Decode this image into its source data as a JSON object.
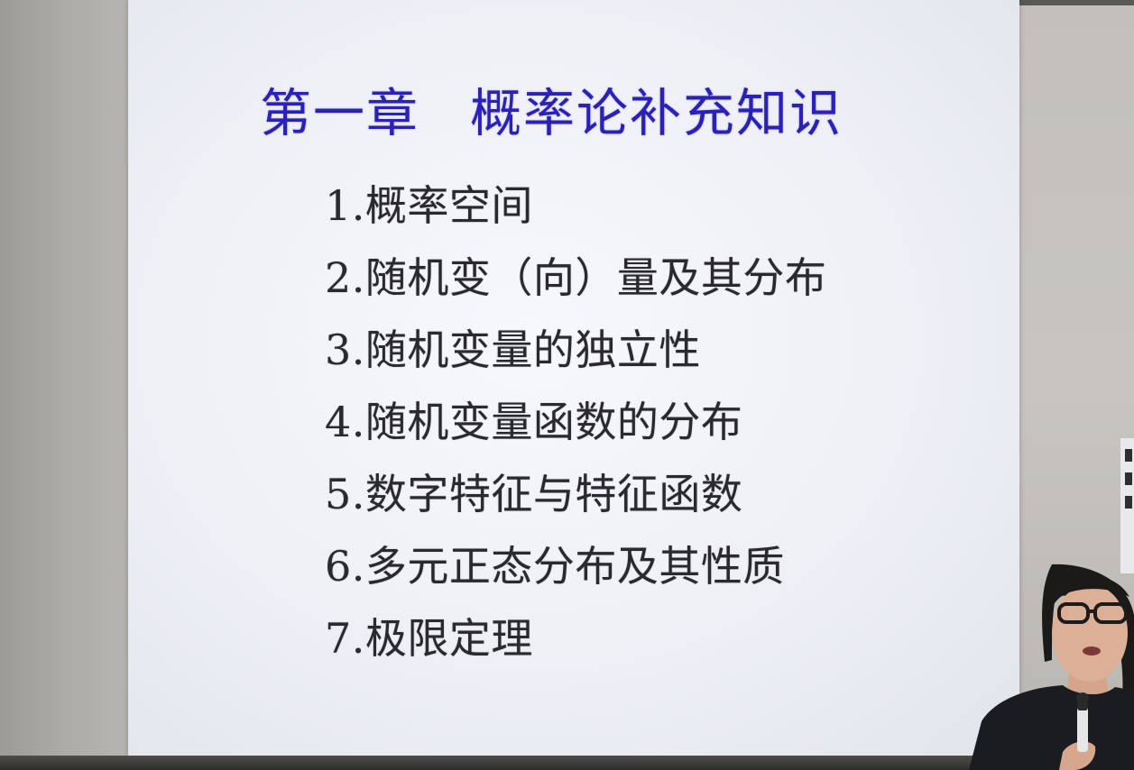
{
  "slide": {
    "title_part1": "第一章",
    "title_part2": "概率论补充知识",
    "items": [
      "1.概率空间",
      "2.随机变（向）量及其分布",
      "3.随机变量的独立性",
      "4.随机变量函数的分布",
      "5.数字特征与特征函数",
      "6.多元正态分布及其性质",
      "7.极限定理"
    ]
  },
  "colors": {
    "title": "#2b21b8",
    "body_text": "#2a2a2e",
    "screen": "#eef0f6",
    "wall": "#b3b1ad"
  }
}
